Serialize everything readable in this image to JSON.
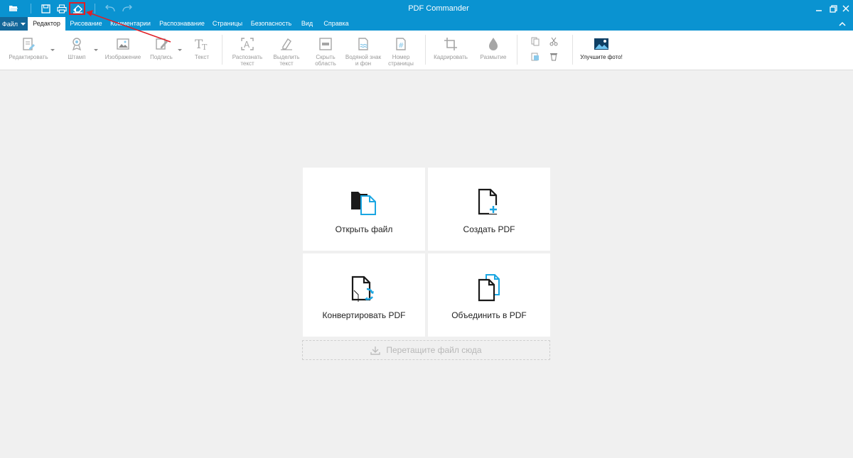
{
  "app": {
    "title": "PDF Commander"
  },
  "colors": {
    "accent": "#0a93d1",
    "file_menu": "#12679a",
    "highlight": "#e01f26",
    "icon_blue": "#1aa6e2"
  },
  "quick_access": [
    "open-folder-icon",
    "save-icon",
    "print-icon",
    "eraser-icon",
    "undo-icon",
    "redo-icon"
  ],
  "menu": {
    "file_label": "Файл",
    "tabs": [
      {
        "label": "Редактор",
        "active": true
      },
      {
        "label": "Рисование"
      },
      {
        "label": "Комментарии"
      },
      {
        "label": "Распознавание"
      },
      {
        "label": "Страницы"
      },
      {
        "label": "Безопасность"
      },
      {
        "label": "Вид"
      },
      {
        "label": "Справка"
      }
    ]
  },
  "ribbon": {
    "edit": "Редактировать",
    "stamp": "Штамп",
    "image": "Изображение",
    "signature": "Подпись",
    "text": "Текст",
    "recognize_1": "Распознать",
    "recognize_2": "текст",
    "select_1": "Выделить",
    "select_2": "текст",
    "hide_1": "Скрыть",
    "hide_2": "область",
    "watermark_1": "Водяной знак",
    "watermark_2": "и фон",
    "pagenum_1": "Номер",
    "pagenum_2": "страницы",
    "crop": "Кадрировать",
    "blur": "Размытие",
    "improve": "Улучшите фото!"
  },
  "start": {
    "open": "Открыть файл",
    "create": "Создать PDF",
    "convert": "Конвертировать PDF",
    "merge": "Объединить в PDF",
    "drop": "Перетащите файл сюда"
  }
}
